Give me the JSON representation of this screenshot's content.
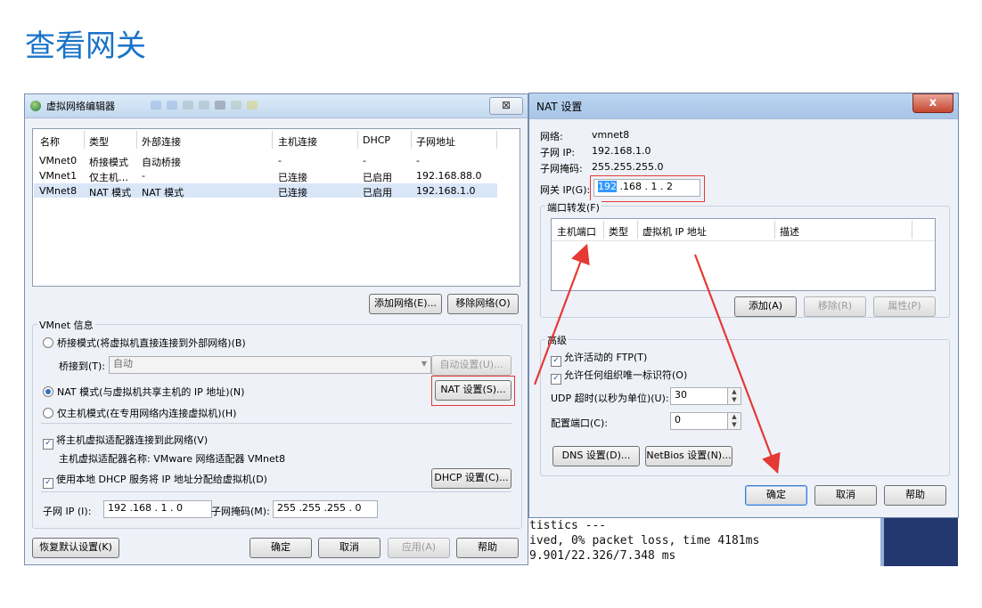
{
  "slide": {
    "title": "查看网关"
  },
  "terminal": {
    "lines": [
      "tistics ---",
      "ived, 0% packet loss, time 4181ms",
      "9.901/22.326/7.348 ms"
    ]
  },
  "vnet_editor": {
    "title": "虚拟网络编辑器",
    "close": "⊠",
    "columns": [
      "名称",
      "类型",
      "外部连接",
      "主机连接",
      "DHCP",
      "子网地址"
    ],
    "rows": [
      {
        "name": "VMnet0",
        "type": "桥接模式",
        "external": "自动桥接",
        "host": "-",
        "dhcp": "-",
        "subnet": "-"
      },
      {
        "name": "VMnet1",
        "type": "仅主机…",
        "external": "-",
        "host": "已连接",
        "dhcp": "已启用",
        "subnet": "192.168.88.0"
      },
      {
        "name": "VMnet8",
        "type": "NAT 模式",
        "external": "NAT 模式",
        "host": "已连接",
        "dhcp": "已启用",
        "subnet": "192.168.1.0"
      }
    ],
    "add_network": "添加网络(E)...",
    "remove_network": "移除网络(O)",
    "vmnet_info": "VMnet 信息",
    "bridge_mode": "桥接模式(将虚拟机直接连接到外部网络)(B)",
    "bridge_to_label": "桥接到(T):",
    "bridge_to_value": "自动",
    "auto_settings": "自动设置(U)...",
    "nat_mode": "NAT 模式(与虚拟机共享主机的 IP 地址)(N)",
    "nat_settings": "NAT 设置(S)...",
    "host_only_mode": "仅主机模式(在专用网络内连接虚拟机)(H)",
    "connect_adapter": "将主机虚拟适配器连接到此网络(V)",
    "adapter_name": "主机虚拟适配器名称: VMware 网络适配器 VMnet8",
    "use_dhcp": "使用本地 DHCP 服务将 IP 地址分配给虚拟机(D)",
    "dhcp_settings": "DHCP 设置(C)...",
    "subnet_ip_label": "子网 IP (I):",
    "subnet_ip": "192 .168 .  1  .  0",
    "subnet_mask_label": "子网掩码(M):",
    "subnet_mask": "255 .255 .255 .  0",
    "restore_defaults": "恢复默认设置(K)",
    "ok": "确定",
    "cancel": "取消",
    "apply": "应用(A)",
    "help": "帮助"
  },
  "nat_dialog": {
    "title": "NAT 设置",
    "close": "x",
    "network_label": "网络:",
    "network_value": "vmnet8",
    "subnet_ip_label": "子网 IP:",
    "subnet_ip_value": "192.168.1.0",
    "subnet_mask_label": "子网掩码:",
    "subnet_mask_value": "255.255.255.0",
    "gateway_label": "网关 IP(G):",
    "gateway_first": "192",
    "gateway_rest": " .168 .  1  .  2",
    "port_forwarding": "端口转发(F)",
    "pf_columns": [
      "主机端口",
      "类型",
      "虚拟机 IP 地址",
      "描述"
    ],
    "add": "添加(A)",
    "remove": "移除(R)",
    "properties": "属性(P)",
    "advanced": "高级",
    "allow_ftp": "允许活动的 FTP(T)",
    "allow_uid": "允许任何组织唯一标识符(O)",
    "udp_timeout_label": "UDP 超时(以秒为单位)(U):",
    "udp_timeout": "30",
    "config_port_label": "配置端口(C):",
    "config_port": "0",
    "dns_settings": "DNS 设置(D)...",
    "netbios_settings": "NetBios 设置(N)...",
    "ok": "确定",
    "cancel": "取消",
    "help": "帮助"
  },
  "colors": {
    "title_blue": "#1a73c8",
    "annotation_red": "#e53935"
  }
}
